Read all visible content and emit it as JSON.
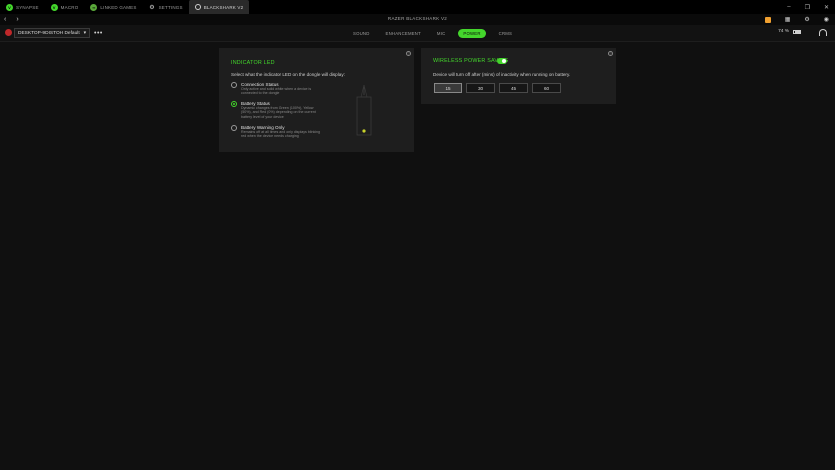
{
  "tabs": [
    {
      "label": "SYNAPSE",
      "icon": "razer-icon",
      "active": false
    },
    {
      "label": "MACRO",
      "icon": "macro-icon",
      "active": false
    },
    {
      "label": "LINKED GAMES",
      "icon": "games-icon",
      "active": false
    },
    {
      "label": "SETTINGS",
      "icon": "gear-icon",
      "active": false
    },
    {
      "label": "BLACKSHARK V2",
      "icon": "headset-icon",
      "active": true
    }
  ],
  "window": {
    "title": "RAZER BLACKSHARK V2",
    "minimize": "–",
    "restore": "❐",
    "close": "✕"
  },
  "toolbar": {
    "back": "‹",
    "forward": "›",
    "refresh": "↻",
    "grid": "▦",
    "bell": "🔔",
    "settings": "⚙",
    "user": "◉"
  },
  "profile": {
    "name": "DESKTOP-9DISTOH Default",
    "more": "•••"
  },
  "subtabs": [
    "SOUND",
    "ENHANCEMENT",
    "MIC",
    "POWER",
    "CRMS"
  ],
  "active_subtab": "POWER",
  "battery": {
    "percent": "74 %"
  },
  "indicator_led": {
    "heading": "INDICATOR LED",
    "prompt": "Select what the indicator LED on the dongle will display:",
    "options": [
      {
        "title": "Connection Status",
        "sub": "Only active and solid white when a device is connected to the dongle",
        "selected": false
      },
      {
        "title": "Battery Status",
        "sub": "Dynamic changes from Green (100%), Yellow (50%), and Red (0%) depending on the current battery level of your device",
        "selected": true
      },
      {
        "title": "Battery Warning Only",
        "sub": "Remains off at all times and only displays blinking red when the device needs charging",
        "selected": false
      }
    ]
  },
  "power_saving": {
    "heading": "WIRELESS POWER SAVING",
    "enabled": true,
    "desc": "Device will turn off after (mins) of inactivity when running on battery.",
    "options": [
      "15",
      "30",
      "45",
      "60"
    ],
    "selected": "15"
  },
  "colors": {
    "accent": "#44d62c"
  }
}
